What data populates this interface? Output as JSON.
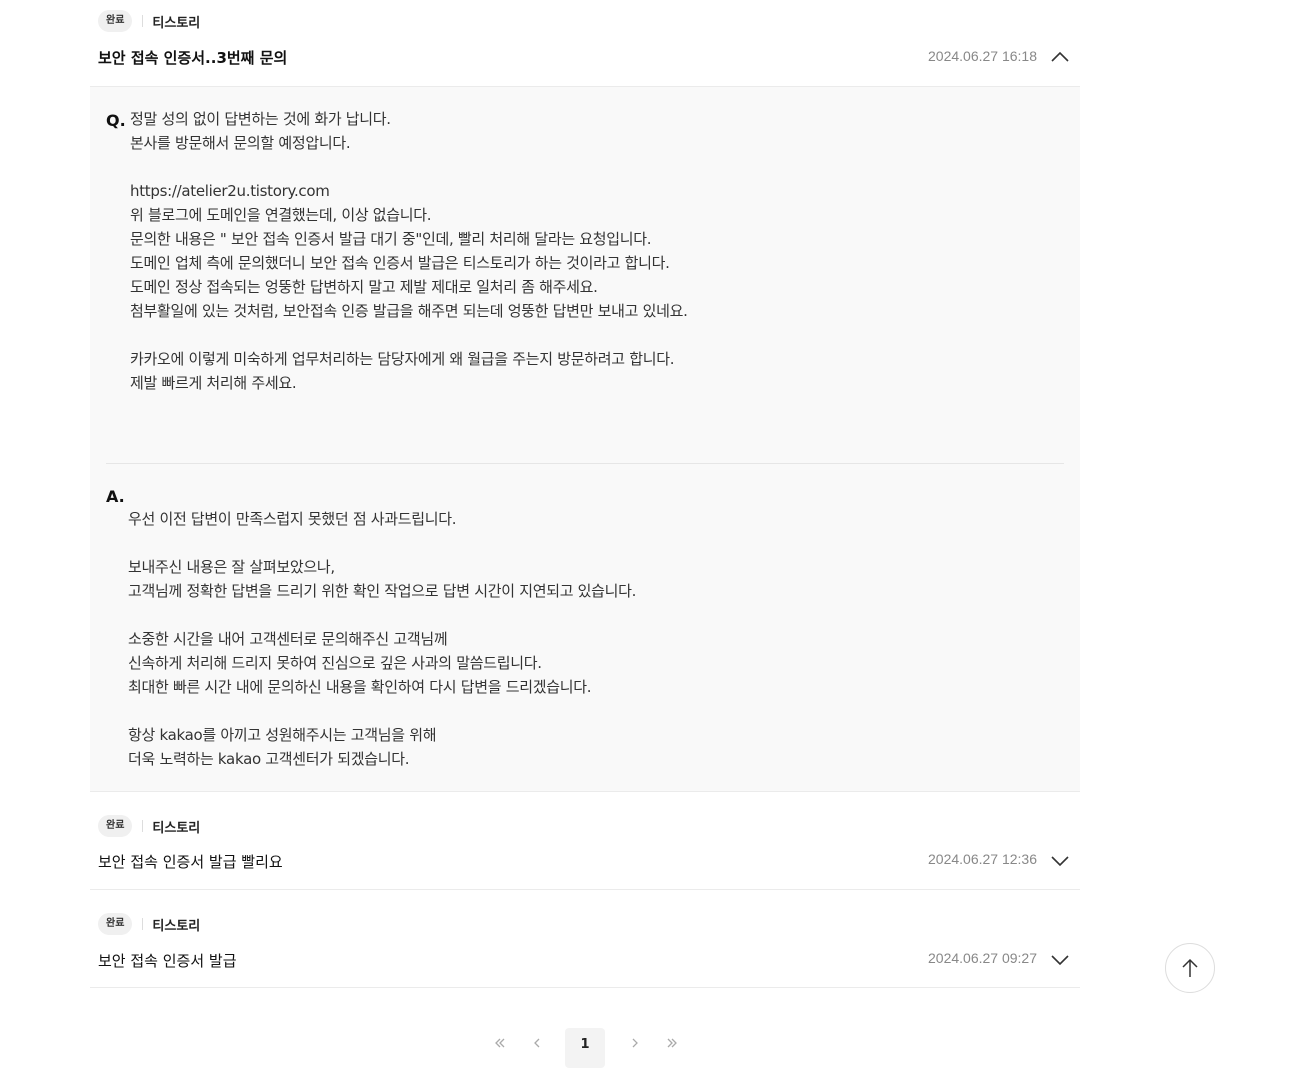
{
  "inquiries": [
    {
      "status": "완료",
      "service": "티스토리",
      "title": "보안 접속 인증서..3번째 문의",
      "date": "2024.06.27 16:18",
      "expanded": true,
      "question_marker": "Q.",
      "question": "정말 성의 없이 답변하는 것에 화가 납니다.\n본사를 방문해서 문의할 예정압니다.\n\nhttps://atelier2u.tistory.com\n위 블로그에 도메인을 연결했는데, 이상 없습니다.\n문의한 내용은 \" 보안 접속 인증서 발급 대기 중\"인데, 빨리 처리해 달라는 요청입니다.\n도메인 업체 측에 문의했더니 보안 접속 인증서 발급은 티스토리가 하는 것이라고 합니다.\n도메인 정상 접속되는 엉뚱한 답변하지 말고 제발 제대로 일처리 좀 해주세요.\n첨부활일에 있는 것처럼, 보안접속 인증 발급을 해주면 되는데 엉뚱한 답변만 보내고 있네요.\n\n카카오에 이렇게 미숙하게 업무처리하는 담당자에게 왜 월급을 주는지 방문하려고 합니다.\n제발 빠르게 처리해 주세요.",
      "answer_marker": "A.",
      "answer": "우선 이전 답변이 만족스럽지 못했던 점 사과드립니다.\n\n보내주신 내용은 잘 살펴보았으나,\n고객님께 정확한 답변을 드리기 위한 확인 작업으로 답변 시간이 지연되고 있습니다.\n\n소중한 시간을 내어 고객센터로 문의해주신 고객님께\n신속하게 처리해 드리지 못하여 진심으로 깊은 사과의 말씀드립니다.\n최대한 빠른 시간 내에 문의하신 내용을 확인하여 다시 답변을 드리겠습니다.\n\n항상 kakao를 아끼고 성원해주시는 고객님을 위해\n더욱 노력하는 kakao 고객센터가 되겠습니다."
    },
    {
      "status": "완료",
      "service": "티스토리",
      "title": "보안 접속 인증서 발급 빨리요",
      "date": "2024.06.27 12:36",
      "expanded": false
    },
    {
      "status": "완료",
      "service": "티스토리",
      "title": "보안 접속 인증서 발급",
      "date": "2024.06.27 09:27",
      "expanded": false
    }
  ],
  "pagination": {
    "current_page": "1"
  },
  "icons": {
    "collapse": "chevron-up-icon",
    "expand": "chevron-down-icon",
    "scroll_top": "arrow-up-icon",
    "first_page": "double-chevron-left-icon",
    "prev_page": "chevron-left-icon",
    "next_page": "chevron-right-icon",
    "last_page": "double-chevron-right-icon"
  }
}
